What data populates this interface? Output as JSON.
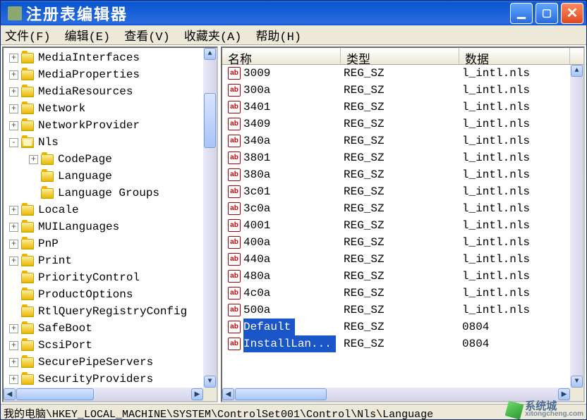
{
  "window": {
    "title": "注册表编辑器"
  },
  "menu": {
    "file": "文件(F)",
    "edit": "编辑(E)",
    "view": "查看(V)",
    "fav": "收藏夹(A)",
    "help": "帮助(H)"
  },
  "tree": [
    {
      "level": 0,
      "expander": "+",
      "label": "MediaInterfaces"
    },
    {
      "level": 0,
      "expander": "+",
      "label": "MediaProperties"
    },
    {
      "level": 0,
      "expander": "+",
      "label": "MediaResources"
    },
    {
      "level": 0,
      "expander": "+",
      "label": "Network"
    },
    {
      "level": 0,
      "expander": "+",
      "label": "NetworkProvider"
    },
    {
      "level": 0,
      "expander": "-",
      "label": "Nls",
      "open": true
    },
    {
      "level": 1,
      "expander": "+",
      "label": "CodePage"
    },
    {
      "level": 1,
      "expander": "",
      "label": "Language"
    },
    {
      "level": 1,
      "expander": "",
      "label": "Language Groups"
    },
    {
      "level": 0,
      "expander": "+",
      "label": "Locale"
    },
    {
      "level": 0,
      "expander": "+",
      "label": "MUILanguages"
    },
    {
      "level": 0,
      "expander": "+",
      "label": "PnP"
    },
    {
      "level": 0,
      "expander": "+",
      "label": "Print"
    },
    {
      "level": 0,
      "expander": "",
      "label": "PriorityControl"
    },
    {
      "level": 0,
      "expander": "",
      "label": "ProductOptions"
    },
    {
      "level": 0,
      "expander": "",
      "label": "RtlQueryRegistryConfig"
    },
    {
      "level": 0,
      "expander": "+",
      "label": "SafeBoot"
    },
    {
      "level": 0,
      "expander": "+",
      "label": "ScsiPort"
    },
    {
      "level": 0,
      "expander": "+",
      "label": "SecurePipeServers"
    },
    {
      "level": 0,
      "expander": "+",
      "label": "SecurityProviders"
    }
  ],
  "columns": {
    "name": "名称",
    "type": "类型",
    "data": "数据"
  },
  "values": [
    {
      "name": "3009",
      "type": "REG_SZ",
      "data": "l_intl.nls"
    },
    {
      "name": "300a",
      "type": "REG_SZ",
      "data": "l_intl.nls"
    },
    {
      "name": "3401",
      "type": "REG_SZ",
      "data": "l_intl.nls"
    },
    {
      "name": "3409",
      "type": "REG_SZ",
      "data": "l_intl.nls"
    },
    {
      "name": "340a",
      "type": "REG_SZ",
      "data": "l_intl.nls"
    },
    {
      "name": "3801",
      "type": "REG_SZ",
      "data": "l_intl.nls"
    },
    {
      "name": "380a",
      "type": "REG_SZ",
      "data": "l_intl.nls"
    },
    {
      "name": "3c01",
      "type": "REG_SZ",
      "data": "l_intl.nls"
    },
    {
      "name": "3c0a",
      "type": "REG_SZ",
      "data": "l_intl.nls"
    },
    {
      "name": "4001",
      "type": "REG_SZ",
      "data": "l_intl.nls"
    },
    {
      "name": "400a",
      "type": "REG_SZ",
      "data": "l_intl.nls"
    },
    {
      "name": "440a",
      "type": "REG_SZ",
      "data": "l_intl.nls"
    },
    {
      "name": "480a",
      "type": "REG_SZ",
      "data": "l_intl.nls"
    },
    {
      "name": "4c0a",
      "type": "REG_SZ",
      "data": "l_intl.nls"
    },
    {
      "name": "500a",
      "type": "REG_SZ",
      "data": "l_intl.nls"
    },
    {
      "name": "Default",
      "type": "REG_SZ",
      "data": "0804",
      "selected": true
    },
    {
      "name": "InstallLan...",
      "type": "REG_SZ",
      "data": "0804",
      "selected": true
    }
  ],
  "status": "我的电脑\\HKEY_LOCAL_MACHINE\\SYSTEM\\ControlSet001\\Control\\Nls\\Language",
  "watermark": {
    "text1": "系统城",
    "text2": "xitongcheng.com"
  }
}
